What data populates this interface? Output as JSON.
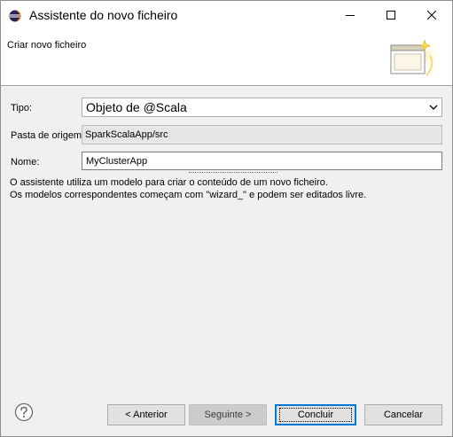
{
  "window": {
    "title": "Assistente do novo ficheiro",
    "app_icon": "eclipse-icon",
    "controls": {
      "minimize": "minimize-icon",
      "maximize": "maximize-icon",
      "close": "close-icon"
    }
  },
  "banner": {
    "title": "Criar novo ficheiro",
    "image": "new-file-wizard-icon"
  },
  "form": {
    "tipo": {
      "label": "Tipo:",
      "value": "Objeto de @Scala"
    },
    "pasta": {
      "label": "Pasta de origem:",
      "value": "SparkScalaApp/src"
    },
    "nome": {
      "label": "Nome:",
      "value": "MyClusterApp"
    }
  },
  "description": {
    "line1": "O assistente utiliza um modelo para criar o conteúdo de um novo ficheiro.",
    "line2": "Os modelos correspondentes começam com \"wizard_\" e podem ser editados livre."
  },
  "footer": {
    "help_icon": "help-icon",
    "back_label": "< Anterior",
    "next_label": "Seguinte >",
    "finish_label": "Concluir",
    "cancel_label": "Cancelar"
  },
  "colors": {
    "accent": "#0078d7",
    "dialog_background": "#f0f0f0",
    "button_face": "#e1e1e1"
  }
}
